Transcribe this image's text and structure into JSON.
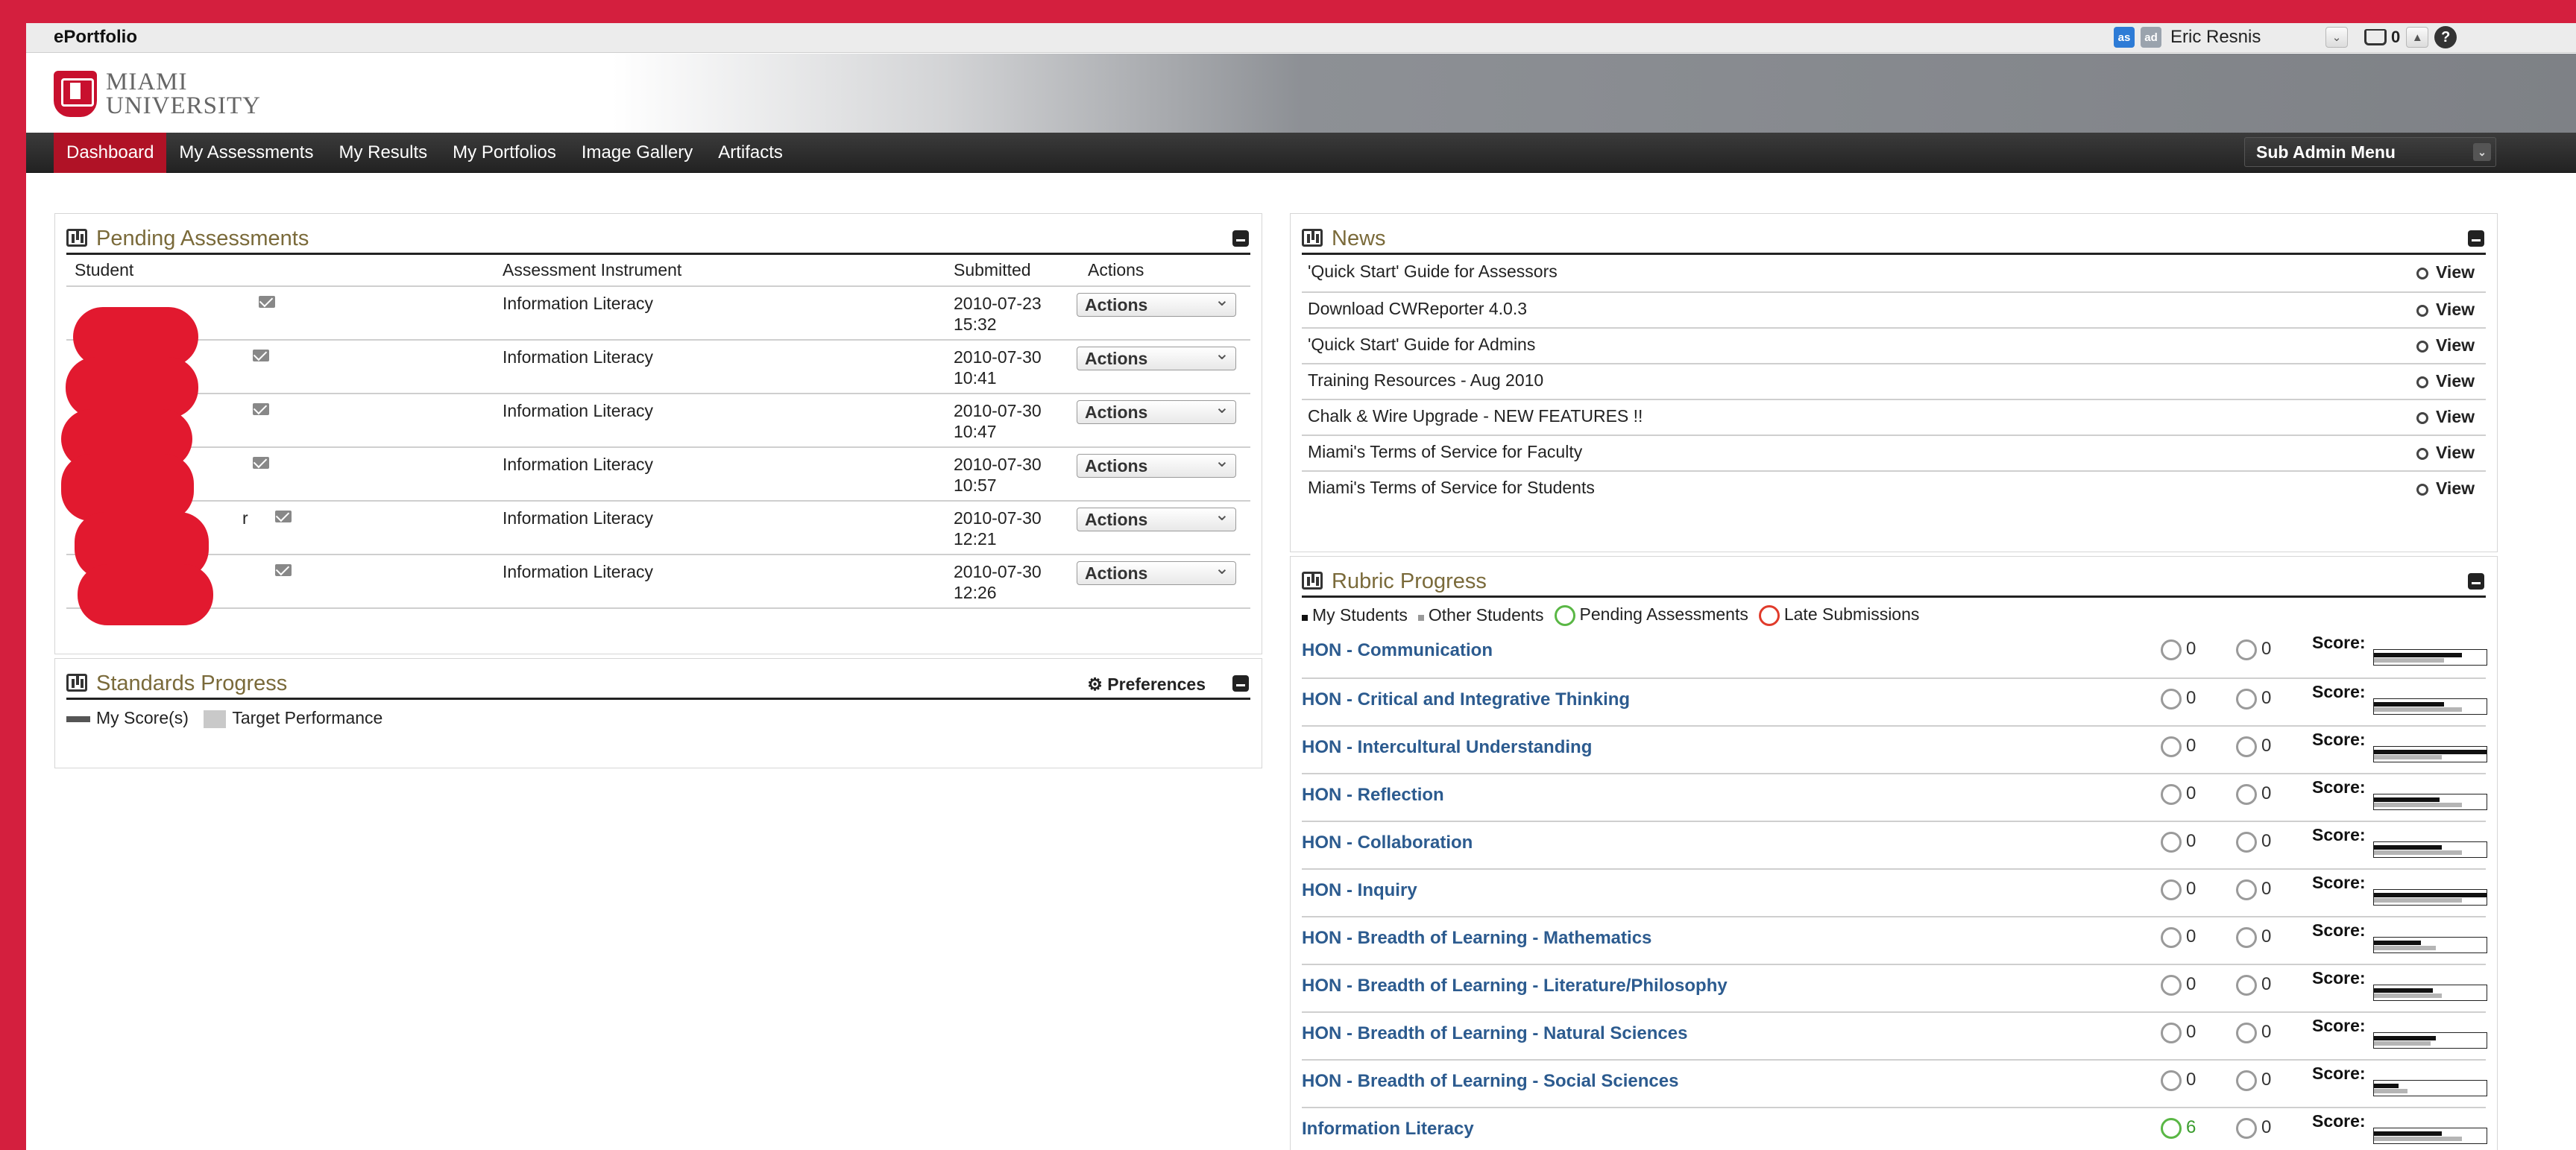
{
  "app_title": "ePortfolio",
  "user": {
    "badge1": "as",
    "badge2": "ad",
    "name": "Eric Resnis",
    "inbox_count": "0",
    "help": "?"
  },
  "logo": {
    "line1": "MIAMI",
    "line2": "UNIVERSITY"
  },
  "nav": {
    "items": [
      "Dashboard",
      "My Assessments",
      "My Results",
      "My Portfolios",
      "Image Gallery",
      "Artifacts"
    ],
    "active": "Dashboard",
    "sub_admin": "Sub Admin Menu"
  },
  "pending": {
    "title": "Pending Assessments",
    "headers": {
      "student": "Student",
      "instrument": "Assessment Instrument",
      "submitted": "Submitted",
      "actions": "Actions"
    },
    "rows": [
      {
        "instrument": "Information Literacy",
        "date": "2010-07-23",
        "time": "15:32",
        "action": "Actions"
      },
      {
        "instrument": "Information Literacy",
        "date": "2010-07-30",
        "time": "10:41",
        "action": "Actions"
      },
      {
        "instrument": "Information Literacy",
        "date": "2010-07-30",
        "time": "10:47",
        "action": "Actions"
      },
      {
        "instrument": "Information Literacy",
        "date": "2010-07-30",
        "time": "10:57",
        "action": "Actions"
      },
      {
        "instrument": "Information Literacy",
        "date": "2010-07-30",
        "time": "12:21",
        "action": "Actions"
      },
      {
        "instrument": "Information Literacy",
        "date": "2010-07-30",
        "time": "12:26",
        "action": "Actions"
      }
    ],
    "row5_fragment": "r"
  },
  "standards": {
    "title": "Standards Progress",
    "preferences": "Preferences",
    "legend_mine": "My Score(s)",
    "legend_target": "Target Performance"
  },
  "news": {
    "title": "News",
    "view_label": "View",
    "items": [
      "'Quick Start' Guide for Assessors",
      "Download CWReporter 4.0.3",
      "'Quick Start' Guide for Admins",
      "Training Resources - Aug 2010",
      "Chalk & Wire Upgrade - NEW FEATURES !!",
      "Miami's Terms of Service for Faculty",
      "Miami's Terms of Service for Students"
    ]
  },
  "rubric": {
    "title": "Rubric Progress",
    "legend": {
      "my_students": "My Students",
      "other_students": "Other Students",
      "pending": "Pending Assessments",
      "late": "Late Submissions"
    },
    "score_label": "Score:",
    "rows": [
      {
        "name": "HON - Communication",
        "pending": "0",
        "late": "0",
        "mine": 0.78,
        "target": 0.62
      },
      {
        "name": "HON - Critical and Integrative Thinking",
        "pending": "0",
        "late": "0",
        "mine": 0.62,
        "target": 0.78
      },
      {
        "name": "HON - Intercultural Understanding",
        "pending": "0",
        "late": "0",
        "mine": 1.0,
        "target": 0.6
      },
      {
        "name": "HON - Reflection",
        "pending": "0",
        "late": "0",
        "mine": 0.58,
        "target": 0.78
      },
      {
        "name": "HON - Collaboration",
        "pending": "0",
        "late": "0",
        "mine": 0.6,
        "target": 0.78
      },
      {
        "name": "HON - Inquiry",
        "pending": "0",
        "late": "0",
        "mine": 1.0,
        "target": 0.78
      },
      {
        "name": "HON - Breadth of Learning - Mathematics",
        "pending": "0",
        "late": "0",
        "mine": 0.42,
        "target": 0.55
      },
      {
        "name": "HON - Breadth of Learning - Literature/Philosophy",
        "pending": "0",
        "late": "0",
        "mine": 0.52,
        "target": 0.6
      },
      {
        "name": "HON - Breadth of Learning - Natural Sciences",
        "pending": "0",
        "late": "0",
        "mine": 0.55,
        "target": 0.5
      },
      {
        "name": "HON - Breadth of Learning - Social Sciences",
        "pending": "0",
        "late": "0",
        "mine": 0.22,
        "target": 0.3
      },
      {
        "name": "Information Literacy",
        "pending": "6",
        "late": "0",
        "mine": 0.6,
        "target": 0.78
      }
    ]
  },
  "colors": {
    "accent": "#d41f3e",
    "nav_active": "#b01226",
    "link": "#2c5b8f",
    "panel_title": "#7a6a3a"
  }
}
